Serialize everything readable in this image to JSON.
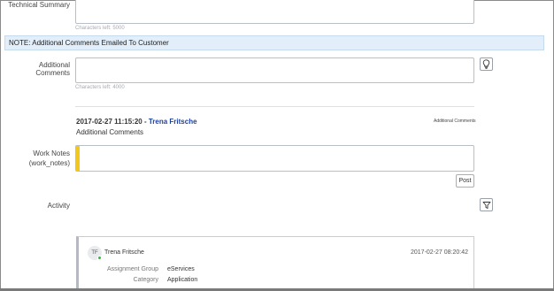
{
  "technical_summary": {
    "label": "Technical Summary",
    "chars_left": "Characters left: 5000"
  },
  "note": {
    "text": "NOTE: Additional Comments Emailed To Customer"
  },
  "additional_comments": {
    "label": "Additional Comments",
    "chars_left": "Characters left: 4000",
    "suggestion_icon": "lightbulb-icon"
  },
  "journal_entry": {
    "timestamp": "2017-02-27 11:15:20",
    "separator": " - ",
    "user": "Trena Fritsche",
    "field_tag": "Additional Comments",
    "body": "Additional Comments"
  },
  "work_notes": {
    "label_line1": "Work Notes",
    "label_line2": "(work_notes)",
    "mandatory_color": "#f2c81b"
  },
  "post_button": {
    "label": "Post"
  },
  "activity": {
    "label": "Activity",
    "filter_icon": "filter-icon",
    "card": {
      "initials": "TF",
      "user": "Trena Fritsche",
      "timestamp": "2017-02-27 08:20:42",
      "fields": [
        {
          "key": "Assignment Group",
          "value": "eServices"
        },
        {
          "key": "Category",
          "value": "Application"
        }
      ]
    }
  },
  "colors": {
    "link": "#1c3f9c",
    "note_bg": "#e2eefa",
    "presence_online": "#3fae49"
  }
}
